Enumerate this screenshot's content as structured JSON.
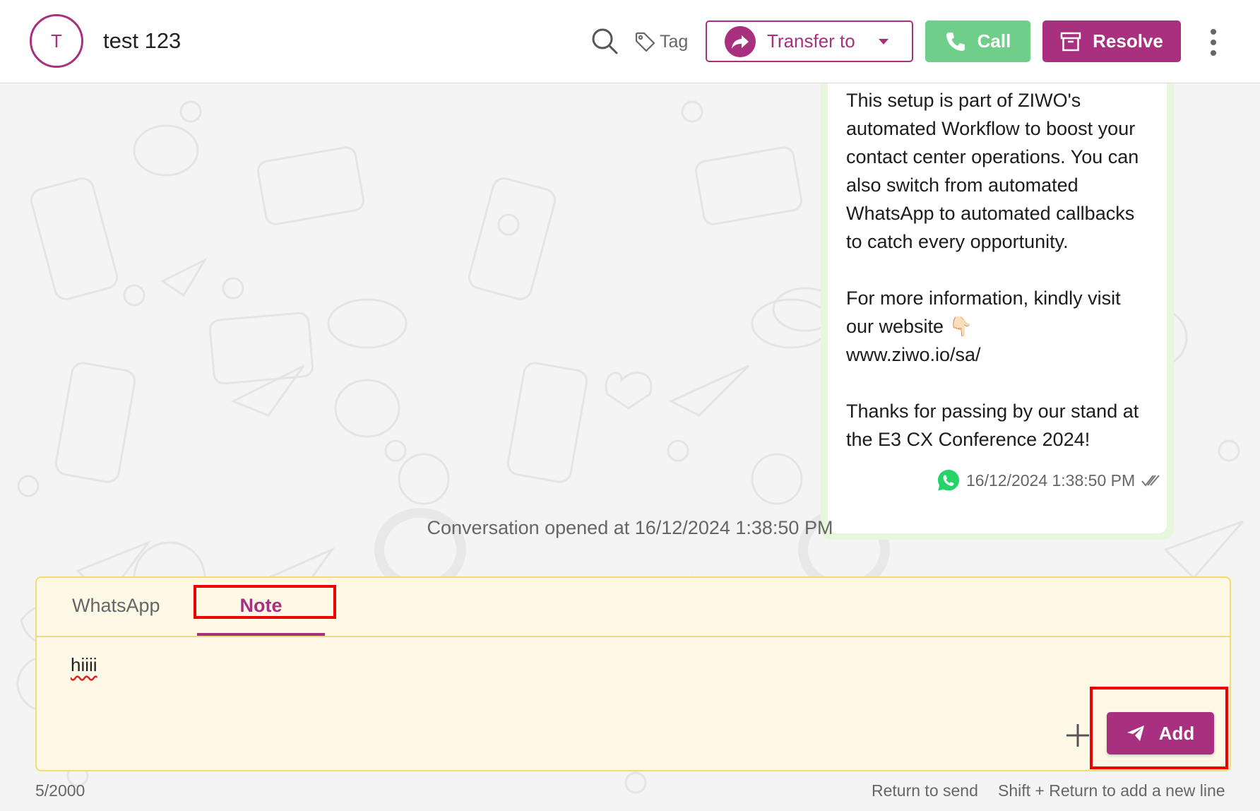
{
  "header": {
    "avatar_initial": "T",
    "contact_name": "test 123",
    "tag_label": "Tag",
    "transfer_label": "Transfer to",
    "call_label": "Call",
    "resolve_label": "Resolve"
  },
  "message": {
    "text_lines": [
      "This setup is part of ZIWO's",
      "automated Workflow to boost your",
      "contact center operations. You can",
      "also switch from automated",
      "WhatsApp to automated callbacks",
      "to catch every opportunity.",
      "",
      "For more information, kindly visit",
      "our website 👇🏻",
      "www.ziwo.io/sa/",
      "",
      "Thanks for passing by our stand at",
      "the E3 CX Conference 2024!"
    ],
    "timestamp": "16/12/2024 1:38:50 PM",
    "channel_icon": "whatsapp-icon",
    "status_icon": "double-check-icon"
  },
  "system_message": "Conversation opened at 16/12/2024 1:38:50 PM",
  "composer": {
    "tabs": [
      {
        "label": "WhatsApp",
        "active": false
      },
      {
        "label": "Note",
        "active": true
      }
    ],
    "input_value": "hiiii",
    "add_label": "Add",
    "char_count": "5/2000",
    "hint_send": "Return to send",
    "hint_newline": "Shift + Return to add a new line"
  },
  "colors": {
    "brand": "#a8307e",
    "call": "#6fcf8a",
    "note_bg": "#fef9e6",
    "note_border": "#f0dc7a",
    "highlight": "#e00000"
  }
}
